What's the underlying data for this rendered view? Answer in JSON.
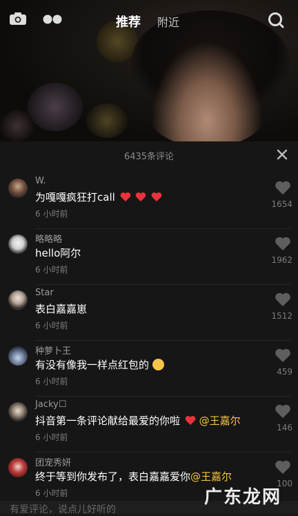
{
  "topbar": {
    "tab_recommend": "推荐",
    "tab_nearby": "附近"
  },
  "panel": {
    "comment_count": "6435条评论"
  },
  "comments": [
    {
      "user": "W.",
      "text": "为嘎嘎疯狂打call",
      "time": "6 小时前",
      "likes": "1654"
    },
    {
      "user": "略略略",
      "text": "hello阿尔",
      "time": "6 小时前",
      "likes": "1962"
    },
    {
      "user": "Star",
      "text": "表白嘉嘉崽",
      "time": "6 小时前",
      "likes": "1512"
    },
    {
      "user": "种萝卜王",
      "text": "有没有像我一样点红包的",
      "time": "6 小时前",
      "likes": "459"
    },
    {
      "user": "Jacky☐",
      "text": "抖音第一条评论献给最爱的你啦",
      "mention": "@王嘉尔",
      "time": "6 小时前",
      "likes": "146"
    },
    {
      "user": "团宠秀妍",
      "text": "终于等到你发布了，表白嘉嘉爱你",
      "mention": "@王嘉尔",
      "time": "6 小时前",
      "likes": "100"
    }
  ],
  "input": {
    "placeholder": "有爱评论，说点儿好听的"
  },
  "watermark": "广东龙网",
  "colors": {
    "mention": "#f5c342",
    "background": "#161616"
  }
}
